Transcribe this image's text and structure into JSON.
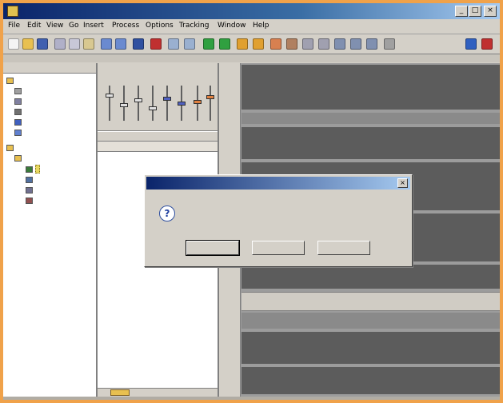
{
  "window": {
    "title": ""
  },
  "menu": [
    "File",
    "Edit",
    "View",
    "Go",
    "Insert",
    "Process",
    "Options",
    "Tracking",
    "Window",
    "Help"
  ],
  "left_pane": {
    "header": "",
    "tree": [
      {
        "label": "",
        "indent": 0
      },
      {
        "label": "",
        "indent": 1
      },
      {
        "label": "",
        "indent": 1
      },
      {
        "label": "",
        "indent": 1
      },
      {
        "label": "",
        "indent": 1
      },
      {
        "label": "",
        "indent": 1
      },
      {
        "label": "",
        "indent": 0
      },
      {
        "label": "",
        "indent": 1
      },
      {
        "label": "",
        "indent": 2,
        "selected": true
      },
      {
        "label": "",
        "indent": 2
      },
      {
        "label": "",
        "indent": 2
      },
      {
        "label": "",
        "indent": 2
      }
    ]
  },
  "mid_pane": {
    "tab": "",
    "subheader": "",
    "columns": [
      "",
      "",
      ""
    ]
  },
  "right_pane": {
    "strip_label": ""
  },
  "dialog": {
    "title": "",
    "message": "",
    "buttons": [
      "",
      "",
      ""
    ]
  },
  "colors": {
    "frame": "#f0a24a",
    "window_bg": "#d4d0c8",
    "title_start": "#0a246a",
    "title_end": "#a6caf0",
    "selection": "#e8d860",
    "track_dark": "#5c5c5c"
  },
  "icons": [
    "app-icon",
    "new-icon",
    "open-icon",
    "save-icon",
    "cut-icon",
    "copy-icon",
    "paste-icon",
    "undo-icon",
    "redo-icon",
    "play-icon",
    "stop-icon",
    "record-icon",
    "question-icon"
  ]
}
